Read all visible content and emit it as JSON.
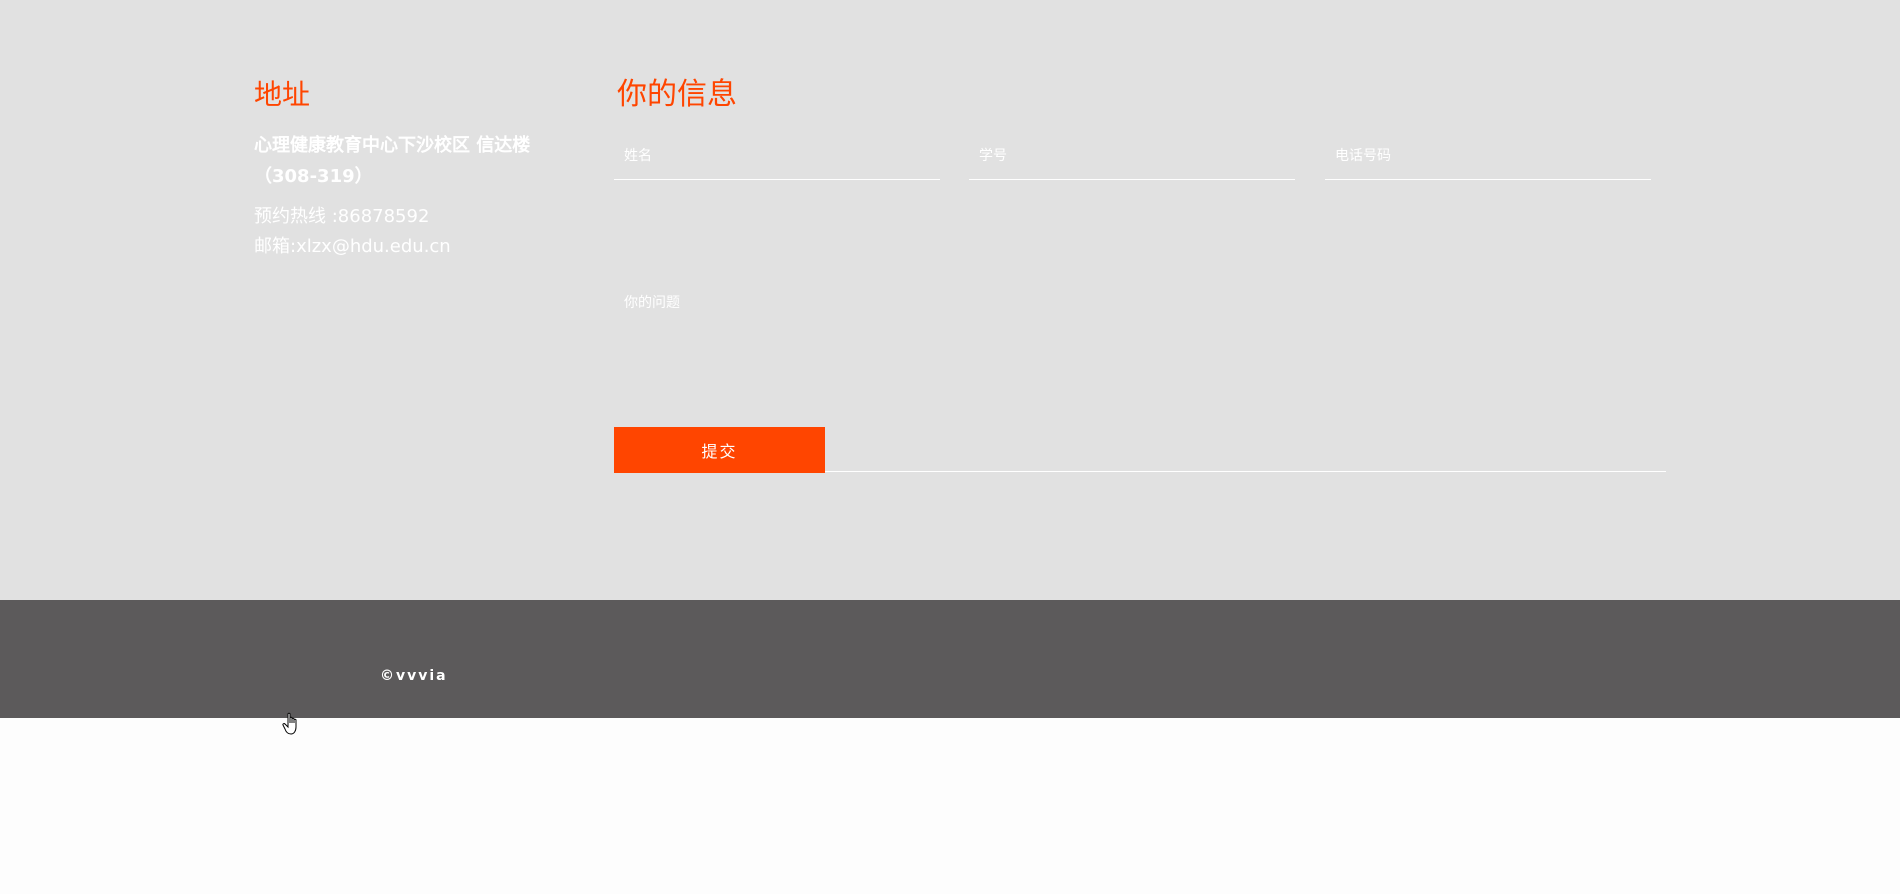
{
  "address": {
    "heading": "地址",
    "location": "心理健康教育中心下沙校区 信达楼（308-319）",
    "hotline": "预约热线 :86878592",
    "email": "邮箱:xlzx@hdu.edu.cn"
  },
  "form": {
    "heading": "你的信息",
    "name_placeholder": "姓名",
    "student_id_placeholder": "学号",
    "phone_placeholder": "电话号码",
    "question_placeholder": "你的问题",
    "submit_label": "提交"
  },
  "footer": {
    "copyright": "©vvvia"
  },
  "colors": {
    "accent": "#ff4500",
    "section_bg": "#e1e1e1",
    "footer_bg": "#5c5a5b"
  },
  "icons": {
    "cursor": "hand-pointer-icon"
  }
}
